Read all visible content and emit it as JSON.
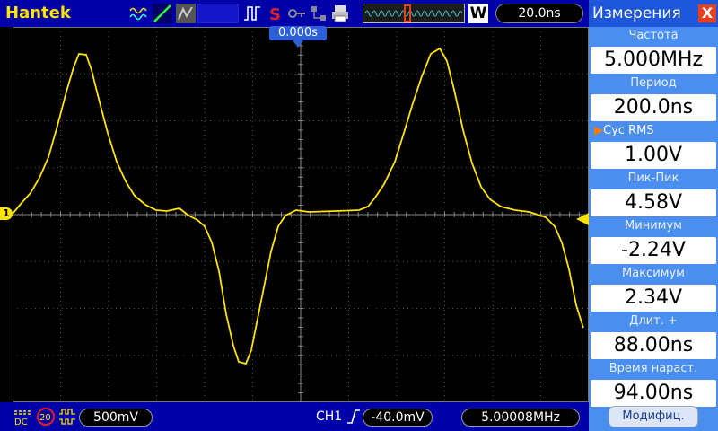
{
  "toolbar": {
    "brand": "Hantek",
    "wave_badge": "W",
    "timebase": "20.0ns"
  },
  "cursor": {
    "label": "0.000s"
  },
  "channel": {
    "marker": "1",
    "color": "#ffe400"
  },
  "bottom": {
    "coupling": "DC",
    "bw_limit": "20",
    "volts_div": "500mV",
    "trigger_source": "CH1",
    "trigger_level": "-40.0mV",
    "frequency": "5.00008MHz"
  },
  "panel": {
    "title": "Измерения",
    "close": "X",
    "measurements": [
      {
        "label": "Частота",
        "value": "5.000MHz"
      },
      {
        "label": "Период",
        "value": "200.0ns"
      },
      {
        "label": "Cyc  RMS",
        "value": "1.00V",
        "selected": true
      },
      {
        "label": "Пик-Пик",
        "value": "4.58V"
      },
      {
        "label": "Минимум",
        "value": "-2.24V"
      },
      {
        "label": "Максимум",
        "value": "2.34V"
      },
      {
        "label": "Длит.  +",
        "value": "88.00ns"
      },
      {
        "label": "Время  нараст.",
        "value": "94.00ns"
      }
    ],
    "modify_button": "Модифиц."
  }
}
